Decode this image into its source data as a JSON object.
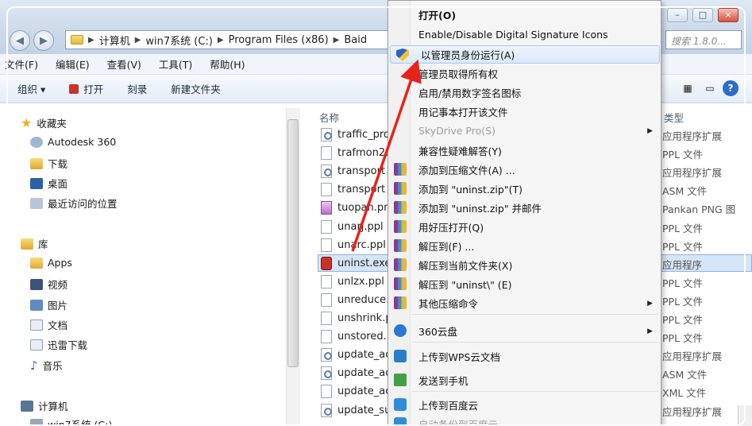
{
  "window": {
    "address": [
      "计算机",
      "win7系统 (C:)",
      "Program Files (x86)",
      "Baid"
    ],
    "search_placeholder": "搜索 1.8.0...",
    "controls": {
      "minimize": "–",
      "maximize": "□",
      "close": "×"
    }
  },
  "menubar": [
    "文件(F)",
    "编辑(E)",
    "查看(V)",
    "工具(T)",
    "帮助(H)"
  ],
  "toolbar": {
    "organize": "组织 ▾",
    "open": "打开",
    "burn": "刻录",
    "new_folder": "新建文件夹"
  },
  "sidebar": {
    "favorites_header": "收藏夹",
    "favorites": [
      "Autodesk 360",
      "下载",
      "桌面",
      "最近访问的位置"
    ],
    "libraries_header": "库",
    "libraries": [
      "Apps",
      "视频",
      "图片",
      "文档",
      "迅雷下载",
      "音乐"
    ],
    "computer_header": "计算机",
    "computer": [
      "win7系统 (C:)"
    ]
  },
  "filelist": {
    "name_header": "名称",
    "type_header": "类型",
    "files": [
      {
        "name": "traffic_pro",
        "icon": "gear"
      },
      {
        "name": "trafmon2.",
        "icon": "doc"
      },
      {
        "name": "transport",
        "icon": "gear"
      },
      {
        "name": "transport",
        "icon": "doc"
      },
      {
        "name": "tuopan.pn",
        "icon": "png"
      },
      {
        "name": "unarj.ppl",
        "icon": "doc"
      },
      {
        "name": "unarc.ppl",
        "icon": "doc"
      },
      {
        "name": "uninst.exe",
        "icon": "exe"
      },
      {
        "name": "unlzx.ppl",
        "icon": "doc"
      },
      {
        "name": "unreduce.",
        "icon": "doc"
      },
      {
        "name": "unshrink.p",
        "icon": "doc"
      },
      {
        "name": "unstored.",
        "icon": "doc"
      },
      {
        "name": "update_ac",
        "icon": "gear"
      },
      {
        "name": "update_ac",
        "icon": "gear"
      },
      {
        "name": "update_ac",
        "icon": "doc"
      },
      {
        "name": "update_su",
        "icon": "gear"
      }
    ],
    "types": [
      "应用程序扩展",
      "PPL 文件",
      "应用程序扩展",
      "ASM 文件",
      "Pankan PNG 图",
      "PPL 文件",
      "PPL 文件",
      "应用程序",
      "PPL 文件",
      "PPL 文件",
      "PPL 文件",
      "PPL 文件",
      "应用程序扩展",
      "ASM 文件",
      "XML 文件",
      "应用程序扩展"
    ]
  },
  "context_menu": {
    "items": [
      {
        "label": "打开(O)",
        "icon": "",
        "bold": true
      },
      {
        "label": "Enable/Disable Digital Signature Icons",
        "icon": ""
      },
      {
        "label": "以管理员身份运行(A)",
        "icon": "shield",
        "highlight": true
      },
      {
        "label": "管理员取得所有权",
        "icon": ""
      },
      {
        "label": "启用/禁用数字签名图标",
        "icon": ""
      },
      {
        "label": "用记事本打开该文件",
        "icon": ""
      },
      {
        "label": "SkyDrive Pro(S)",
        "icon": "",
        "disabled": true,
        "submenu": true
      },
      {
        "label": "兼容性疑难解答(Y)",
        "icon": ""
      },
      {
        "label": "添加到压缩文件(A) ...",
        "icon": "rar"
      },
      {
        "label": "添加到 \"uninst.zip\"(T)",
        "icon": "rar"
      },
      {
        "label": "添加到 \"uninst.zip\" 并邮件",
        "icon": "rar"
      },
      {
        "label": "用好压打开(Q)",
        "icon": "rar"
      },
      {
        "label": "解压到(F) ...",
        "icon": "rar"
      },
      {
        "label": "解压到当前文件夹(X)",
        "icon": "rar"
      },
      {
        "label": "解压到 \"uninst\\\" (E)",
        "icon": "rar"
      },
      {
        "label": "其他压缩命令",
        "icon": "rar",
        "submenu": true
      },
      {
        "label": "360云盘",
        "icon": "cloud",
        "submenu": true
      },
      {
        "label": "上传到WPS云文档",
        "icon": "wps"
      },
      {
        "label": "发送到手机",
        "icon": "phone"
      },
      {
        "label": "上传到百度云",
        "icon": "baidu"
      },
      {
        "label": "自动备份到百度云",
        "icon": "baidu",
        "disabled": true
      }
    ]
  },
  "colors": {
    "highlight": "#dbe9f9",
    "arrow": "#e8231c",
    "titlebar": "#cbd9ea"
  }
}
